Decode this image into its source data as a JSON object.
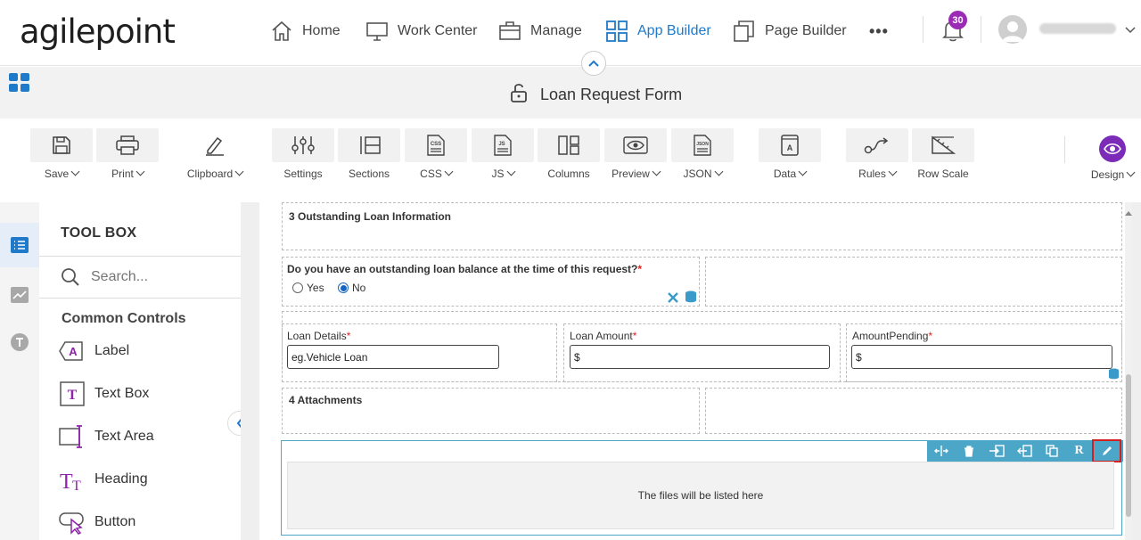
{
  "app": {
    "logo": "agilepoint",
    "nav": [
      {
        "label": "Home",
        "icon": "home-icon"
      },
      {
        "label": "Work Center",
        "icon": "monitor-icon"
      },
      {
        "label": "Manage",
        "icon": "briefcase-icon"
      },
      {
        "label": "App Builder",
        "icon": "grid-icon",
        "active": true
      },
      {
        "label": "Page Builder",
        "icon": "pages-icon"
      }
    ],
    "more": "•••",
    "notifications": "30"
  },
  "form": {
    "title": "Loan Request Form"
  },
  "toolbar": {
    "items": [
      {
        "label": "Save",
        "dropdown": true
      },
      {
        "label": "Print",
        "dropdown": true
      },
      {
        "label": "Clipboard",
        "dropdown": true
      },
      {
        "label": "Settings",
        "dropdown": false
      },
      {
        "label": "Sections",
        "dropdown": false
      },
      {
        "label": "CSS",
        "dropdown": true
      },
      {
        "label": "JS",
        "dropdown": true
      },
      {
        "label": "Columns",
        "dropdown": false
      },
      {
        "label": "Preview",
        "dropdown": true
      },
      {
        "label": "JSON",
        "dropdown": true
      },
      {
        "label": "Data",
        "dropdown": true
      },
      {
        "label": "Rules",
        "dropdown": true
      },
      {
        "label": "Row Scale",
        "dropdown": false
      }
    ],
    "design": "Design"
  },
  "toolbox": {
    "header": "TOOL BOX",
    "search_placeholder": "Search...",
    "section": "Common Controls",
    "items": [
      "Label",
      "Text Box",
      "Text Area",
      "Heading",
      "Button"
    ]
  },
  "canvas": {
    "section3": "3 Outstanding Loan Information",
    "question": "Do you have an outstanding loan balance at the time of this request?",
    "required_mark": "*",
    "opt_yes": "Yes",
    "opt_no": "No",
    "selected_option": "No",
    "loan_details_label": "Loan Details",
    "loan_details_value": "eg.Vehicle Loan",
    "loan_amount_label": "Loan Amount",
    "loan_amount_value": "$",
    "amount_pending_label": "AmountPending",
    "amount_pending_value": "$",
    "section4": "4 Attachments",
    "files_placeholder": "The files will be listed here"
  },
  "colors": {
    "accent": "#1f7ac9",
    "badge": "#9b2ab5",
    "control_bar": "#4ba6c7",
    "highlight": "#d21f1f",
    "design": "#7b2bb8"
  }
}
